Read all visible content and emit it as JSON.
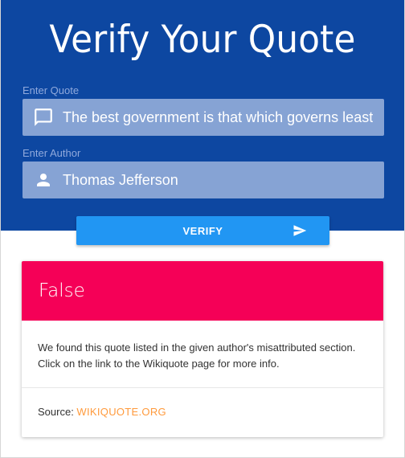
{
  "header": {
    "title": "Verify Your Quote"
  },
  "form": {
    "quote_label": "Enter Quote",
    "quote_value": "The best government is that which governs least",
    "author_label": "Enter Author",
    "author_value": "Thomas Jefferson",
    "verify_label": "VERIFY"
  },
  "result": {
    "verdict": "False",
    "message": "We found this quote listed in the given author's misattributed section. Click on the link to the Wikiquote page for more info.",
    "source_label": "Source: ",
    "source_link": "WIKIQUOTE.ORG"
  },
  "colors": {
    "hero_bg": "#0d47a1",
    "field_bg": "#86a3d4",
    "button_bg": "#2196f3",
    "verdict_bg": "#f50057",
    "link": "#ff9a3c"
  },
  "icons": {
    "quote_field": "chat-bubble-icon",
    "author_field": "person-icon",
    "verify_button": "send-icon"
  }
}
